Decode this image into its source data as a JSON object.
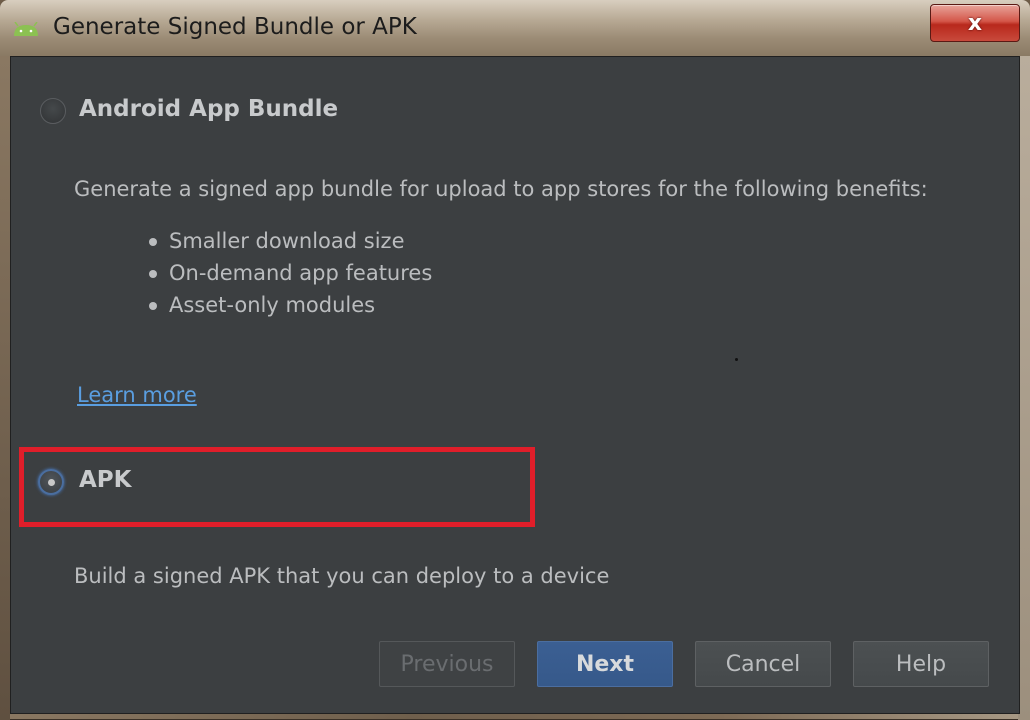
{
  "window": {
    "title": "Generate Signed Bundle or APK",
    "close_label": "x",
    "icon": "android-icon"
  },
  "options": {
    "bundle": {
      "label": "Android App Bundle",
      "selected": false,
      "description": "Generate a signed app bundle for upload to app stores for the following benefits:",
      "benefits": [
        "Smaller download size",
        "On-demand app features",
        "Asset-only modules"
      ],
      "link": "Learn more"
    },
    "apk": {
      "label": "APK",
      "selected": true,
      "description": "Build a signed APK that you can deploy to a device"
    }
  },
  "buttons": {
    "previous": "Previous",
    "next": "Next",
    "cancel": "Cancel",
    "help": "Help"
  },
  "colors": {
    "panel_bg": "#3c3f41",
    "primary_button": "#36598a",
    "link": "#5a9ee0",
    "highlight_border": "#e01e2a"
  }
}
